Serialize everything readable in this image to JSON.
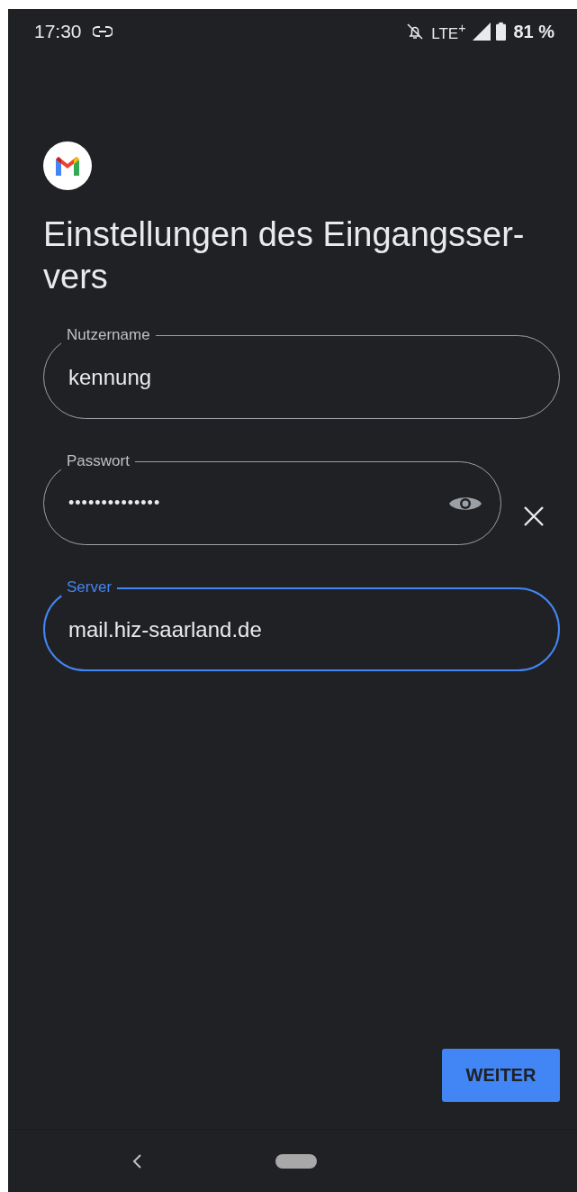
{
  "status_bar": {
    "time": "17:30",
    "network": "LTE$^{+}$",
    "battery": "81 %"
  },
  "title": "Einstellungen des Eingangsser-vers",
  "fields": [
    {
      "kind": "text",
      "label": "Nutzername",
      "value": "kennung",
      "focused": false
    },
    {
      "kind": "password",
      "label": "Passwort",
      "value": "••••••••••••••",
      "focused": false
    },
    {
      "kind": "text",
      "label": "Server",
      "value": "mail.hiz-saarland.de",
      "focused": true
    }
  ],
  "next_button": "WEITER"
}
